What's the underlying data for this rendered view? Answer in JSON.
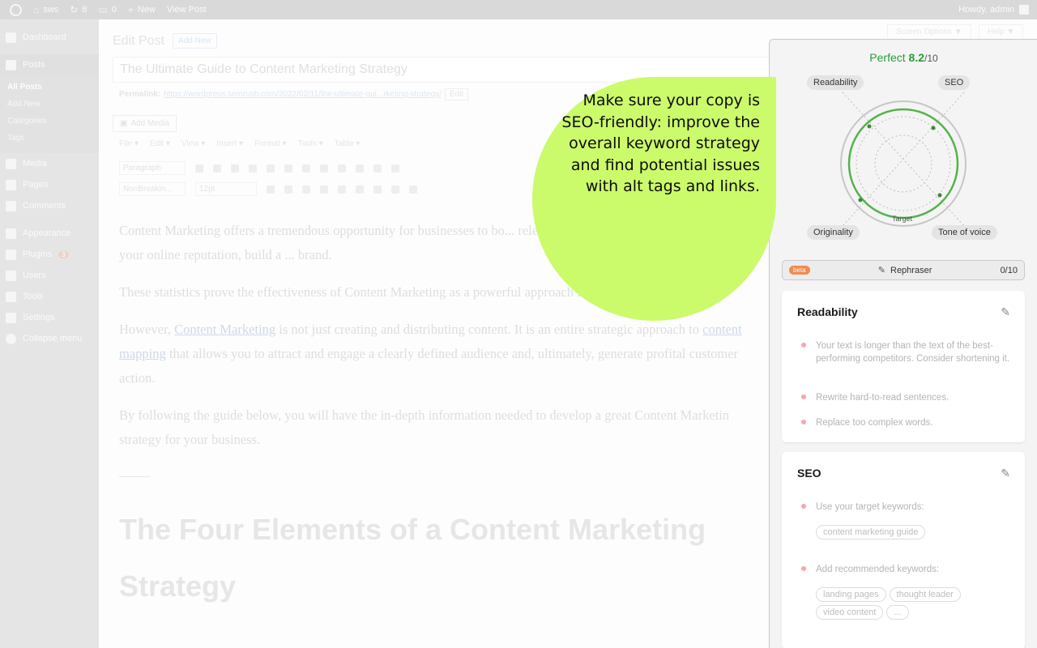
{
  "admin_bar": {
    "site": "sws",
    "updates": "8",
    "comments": "0",
    "new": "New",
    "view_post": "View Post",
    "howdy": "Howdy, admin"
  },
  "admin_menu": {
    "dashboard": "Dashboard",
    "posts": "Posts",
    "posts_sub": [
      "All Posts",
      "Add New",
      "Categories",
      "Tags"
    ],
    "media": "Media",
    "pages": "Pages",
    "comments": "Comments",
    "appearance": "Appearance",
    "plugins": "Plugins",
    "plugins_badge": "3",
    "users": "Users",
    "tools": "Tools",
    "settings": "Settings",
    "collapse": "Collapse menu"
  },
  "editor": {
    "heading": "Edit Post",
    "add_new": "Add New",
    "screen_options": "Screen Options ▼",
    "help": "Help ▼",
    "post_title": "The Ultimate Guide to Content Marketing Strategy",
    "permalink_label": "Permalink:",
    "permalink_url": "https://wordpress.semrush.com/2022/02/11/the-ultimate-gui...rketing-strategy/",
    "permalink_edit": "Edit",
    "add_media": "Add Media",
    "menus": [
      "File ▾",
      "Edit ▾",
      "View ▾",
      "Insert ▾",
      "Format ▾",
      "Tools ▾",
      "Table ▾"
    ],
    "format_select": "Paragraph",
    "font_select": "NonBreakin...",
    "size_select": "12pt",
    "paragraphs": {
      "p1": "Content Marketing offers a tremendous opportunity for businesses to bo... relevant content to users, you can improve your online reputation, build a ... brand.",
      "p2": "These statistics prove the effectiveness of Content Marketing as a powerful approach for ga... online visibility.",
      "p3_a": "However, ",
      "p3_link": "Content Marketing",
      "p3_b": " is not just creating and distributing content. It is an entire strategic approach to ",
      "p3_link2": "content mapping",
      "p3_c": " that allows you to attract and engage a clearly defined audience and, ultimately, generate profital customer action.",
      "p4": "By following the guide below, you will have the in-depth information needed to develop a great Content Marketin strategy for your business."
    },
    "h2": "The Four Elements of a Content Marketing Strategy"
  },
  "callout": {
    "text": "Make sure your copy is SEO-friendly: improve the overall keyword strategy and find potential issues with alt tags and links."
  },
  "panel": {
    "score_word": "Perfect",
    "score_value": "8.2",
    "score_max": "/10",
    "radar": {
      "readability": "Readability",
      "seo": "SEO",
      "originality": "Originality",
      "tone": "Tone of voice",
      "target": "Target"
    },
    "rephraser": {
      "beta": "beta",
      "label": "Rephraser",
      "count": "0/10"
    },
    "readability_card": {
      "title": "Readability",
      "items": [
        "Your text is longer than the text of the best-performing competitors. Consider shortening it.",
        "Rewrite hard-to-read sentences.",
        "Replace too complex words."
      ]
    },
    "seo_card": {
      "title": "SEO",
      "target_label": "Use your target keywords:",
      "target_keywords": [
        "content marketing guide"
      ],
      "recommended_label": "Add recommended keywords:",
      "recommended_keywords": [
        "landing pages",
        "thought leader",
        "video content",
        "..."
      ]
    }
  },
  "colors": {
    "callout": "#cbfa6b",
    "score_green": "#2a9d3a",
    "beta_orange": "#f08a54",
    "dot_pink": "#f2a9ae"
  }
}
